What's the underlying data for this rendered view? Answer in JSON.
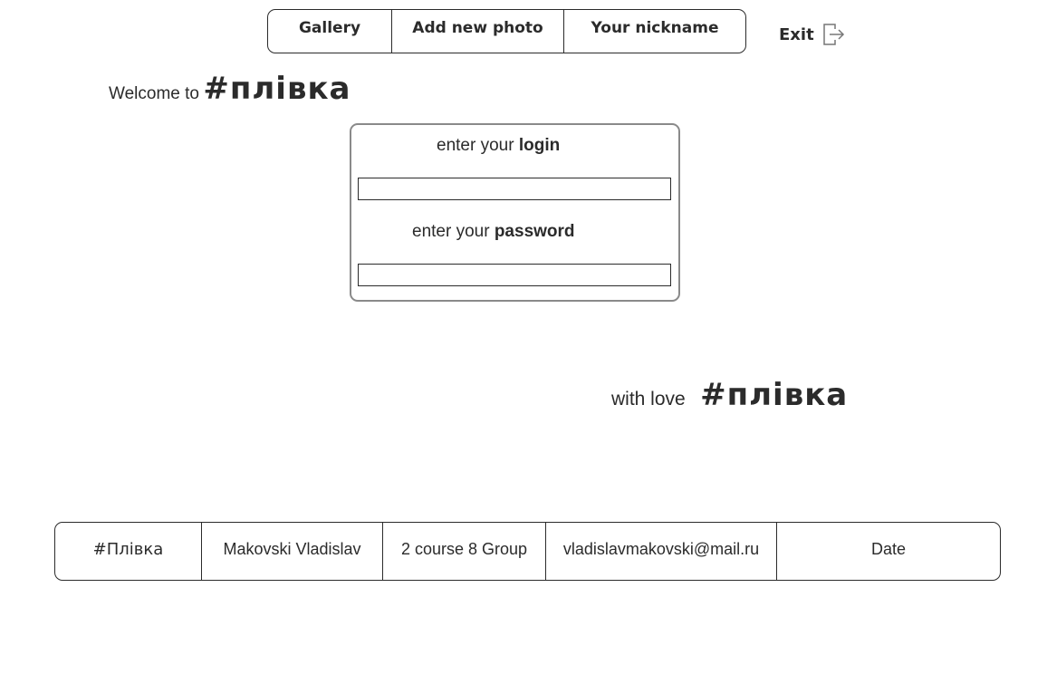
{
  "nav": {
    "gallery": "Gallery",
    "add_photo": "Add new photo",
    "nickname": "Your nickname",
    "exit": "Exit",
    "exit_icon": "exit-icon"
  },
  "welcome": {
    "text": "Welcome to",
    "brand": "#плівка"
  },
  "login_form": {
    "login_prefix": "enter your",
    "login_bold": "login",
    "login_value": "",
    "password_prefix": "enter your",
    "password_bold": "password",
    "password_value": ""
  },
  "with_love": {
    "text": "with love",
    "brand": "#плівка"
  },
  "footer": {
    "brand": "#Плівка",
    "author": "Makovski Vladislav",
    "course": "2 course 8 Group",
    "email": "vladislavmakovski@mail.ru",
    "date": "Date"
  }
}
